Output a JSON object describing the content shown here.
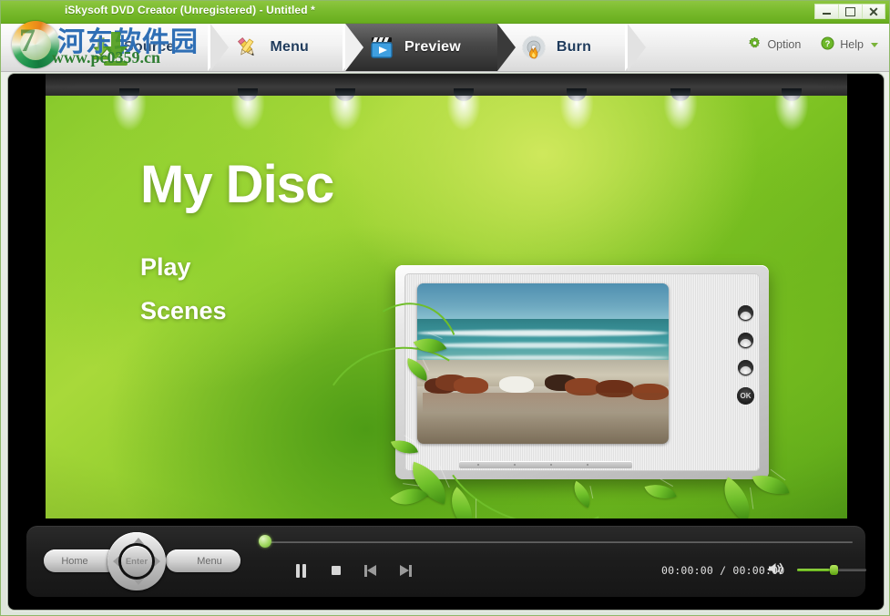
{
  "window": {
    "title": "iSkysoft DVD Creator (Unregistered) - Untitled *",
    "minimize_label": "_",
    "maximize_label": "□",
    "close_label": "✕",
    "accent_green": "#7abb2d",
    "titlebar_text_color": "#ffffff"
  },
  "watermark": {
    "digit": "7",
    "site_cn": "河东软件园",
    "site_url": "www.pc0359.cn"
  },
  "toolbar": {
    "tabs": [
      {
        "label": "Source",
        "icon": "download-arrow-icon",
        "active": false
      },
      {
        "label": "Menu",
        "icon": "pencil-edit-icon",
        "active": false
      },
      {
        "label": "Preview",
        "icon": "clapperboard-play-icon",
        "active": true
      },
      {
        "label": "Burn",
        "icon": "disc-flame-icon",
        "active": false
      }
    ],
    "option_label": "Option",
    "option_icon": "gear-icon",
    "help_label": "Help",
    "help_icon": "question-circle-icon",
    "help_caret_icon": "chevron-down-icon"
  },
  "preview": {
    "disc_title": "My Disc",
    "menu_items": [
      "Play",
      "Scenes"
    ],
    "template_theme": "green-spotlight-tv",
    "spotlight_count": 7,
    "tv": {
      "ok_label": "OK",
      "side_buttons": 3,
      "thumbnail_scene": "horses-running-on-beach"
    }
  },
  "controls": {
    "remote": {
      "home_label": "Home",
      "menu_label": "Menu",
      "enter_label": "Enter",
      "up_icon": "arrow-up-icon",
      "down_icon": "arrow-down-icon",
      "left_icon": "arrow-left-icon",
      "right_icon": "arrow-right-icon"
    },
    "seek": {
      "position_percent": 0
    },
    "buttons": [
      {
        "name": "pause-button",
        "icon": "pause-icon"
      },
      {
        "name": "stop-button",
        "icon": "stop-icon"
      },
      {
        "name": "previous-button",
        "icon": "skip-previous-icon"
      },
      {
        "name": "next-button",
        "icon": "skip-next-icon"
      }
    ],
    "time": {
      "current": "00:00:00",
      "separator": "/",
      "total": "00:00:00"
    },
    "volume": {
      "icon": "speaker-icon",
      "level_percent": 50
    }
  }
}
